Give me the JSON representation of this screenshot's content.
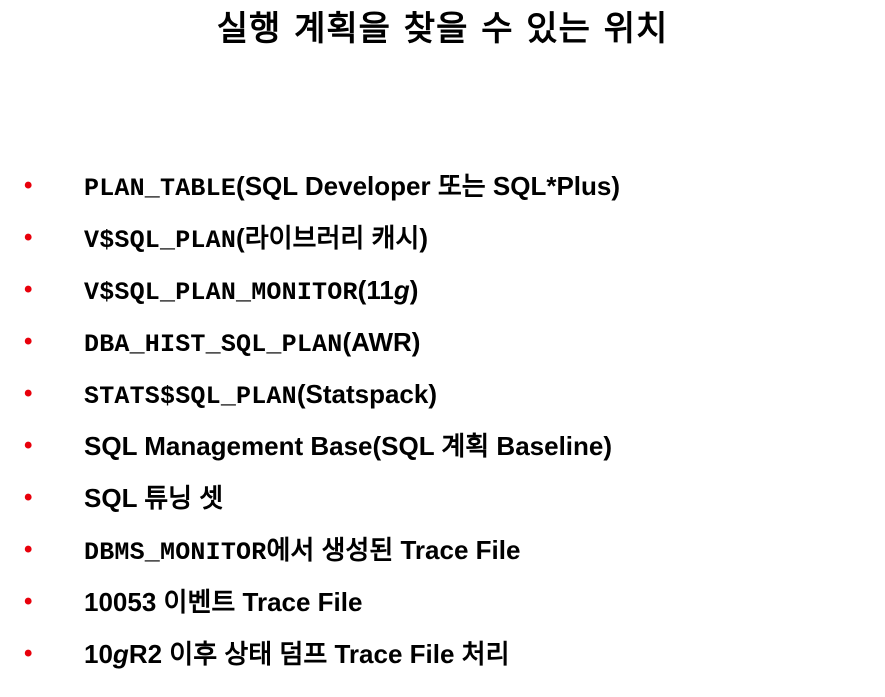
{
  "slide": {
    "title": "실행 계획을 찾을 수 있는 위치",
    "bullet_symbol": "•",
    "bullet_color": "#e8000b"
  },
  "items": [
    {
      "code": "PLAN_TABLE",
      "text": "(SQL Developer 또는 SQL*Plus)"
    },
    {
      "code": "V$SQL_PLAN",
      "text": "(라이브러리 캐시)"
    },
    {
      "code": "V$SQL_PLAN_MONITOR",
      "text_a": "(11",
      "text_em": "g",
      "text_b": ")"
    },
    {
      "code": "DBA_HIST_SQL_PLAN",
      "text": "(AWR)"
    },
    {
      "code": "STATS$SQL_PLAN",
      "text": "(Statspack)"
    },
    {
      "text": "SQL Management Base(SQL 계획 Baseline)"
    },
    {
      "text": "SQL 튜닝 셋"
    },
    {
      "code": "DBMS_MONITOR",
      "text": "에서 생성된 Trace File"
    },
    {
      "text": "10053 이벤트 Trace File"
    },
    {
      "text_a": "10",
      "text_em": "g",
      "text_b": "R2 이후 상태 덤프 Trace File 처리"
    }
  ]
}
